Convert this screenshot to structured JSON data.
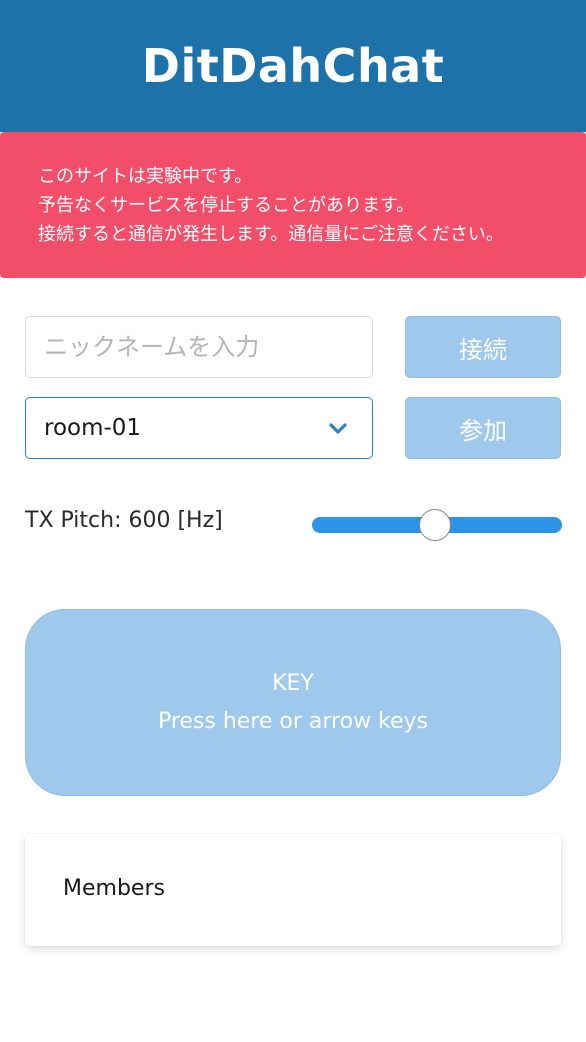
{
  "header": {
    "title": "DitDahChat"
  },
  "notice": {
    "lines": [
      "このサイトは実験中です。",
      "予告なくサービスを停止することがあります。",
      "接続すると通信が発生します。通信量にご注意ください。"
    ]
  },
  "form": {
    "nickname_value": "",
    "nickname_placeholder": "ニックネームを入力",
    "connect_label": "接続",
    "room_selected": "room-01",
    "join_label": "参加"
  },
  "pitch": {
    "label": "TX Pitch: 600 [Hz]",
    "slider_fraction": 0.49
  },
  "key": {
    "line1": "KEY",
    "line2": "Press here or arrow keys"
  },
  "members": {
    "title": "Members"
  },
  "colors": {
    "header_bg": "#1c72a9",
    "notice_bg": "#f24e6a",
    "button_bg": "#9ec8ec",
    "slider_track": "#2b93e8",
    "select_border": "#2f80c8"
  }
}
